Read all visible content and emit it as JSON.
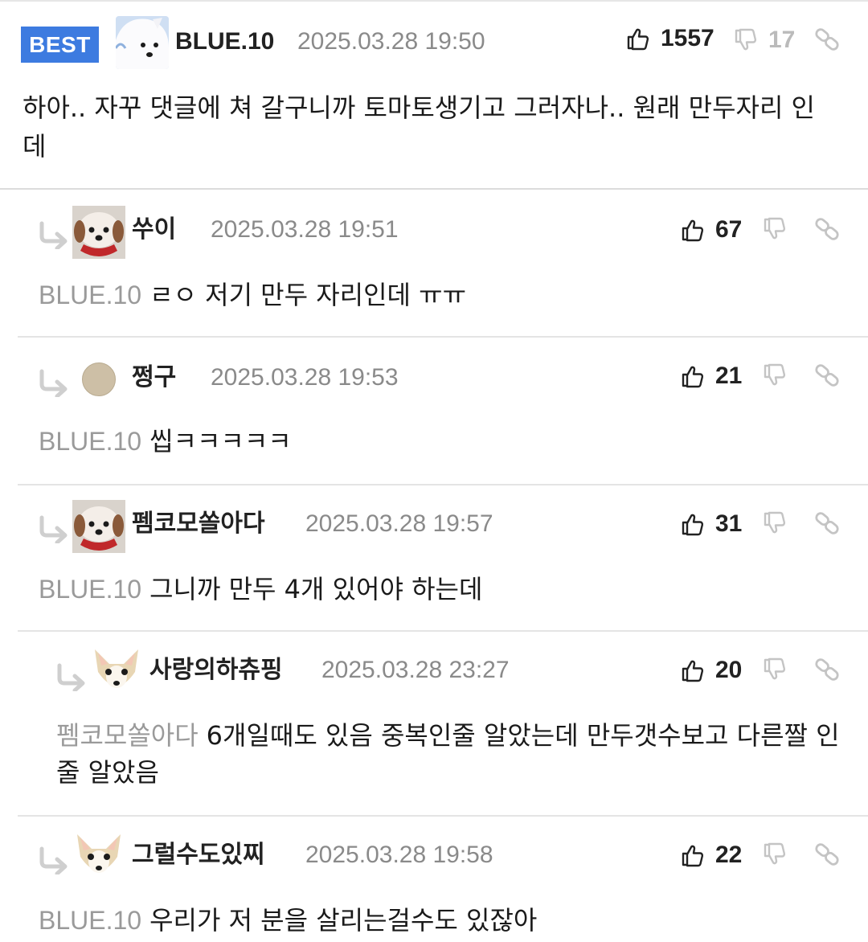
{
  "best": {
    "badge": "BEST",
    "author": "BLUE.10",
    "date": "2025.03.28 19:50",
    "likes": "1557",
    "dislikes": "17",
    "text": "하아.. 자꾸 댓글에 쳐 갈구니까 토마토생기고 그러자나.. 원래 만두자리 인데"
  },
  "replies": [
    {
      "author": "쑤이",
      "date": "2025.03.28 19:51",
      "likes": "67",
      "mention": "BLUE.10",
      "text": "ㄹㅇ 저기 만두 자리인데 ㅠㅠ",
      "avatar_icon": "puppy-avatar-icon"
    },
    {
      "author": "쩡구",
      "date": "2025.03.28 19:53",
      "likes": "21",
      "mention": "BLUE.10",
      "text": "씹ㅋㅋㅋㅋㅋ",
      "avatar_icon": "circle-avatar-icon"
    },
    {
      "author": "펨코모쏠아다",
      "date": "2025.03.28 19:57",
      "likes": "31",
      "mention": "BLUE.10",
      "text": "그니까 만두 4개 있어야 하는데",
      "avatar_icon": "puppy-avatar-icon"
    },
    {
      "author": "사랑의하츄핑",
      "date": "2025.03.28 23:27",
      "likes": "20",
      "mention": "펨코모쏠아다",
      "text": "6개일때도 있음 중복인줄 알았는데 만두갯수보고 다른짤 인줄 알았음",
      "avatar_icon": "chihuahua-avatar-icon"
    },
    {
      "author": "그럴수도있찌",
      "date": "2025.03.28 19:58",
      "likes": "22",
      "mention": "BLUE.10",
      "text": "우리가 저 분을 살리는걸수도 있잖아",
      "avatar_icon": "chihuahua-avatar-icon"
    }
  ],
  "colors": {
    "badge": "#3d7be0",
    "date": "#8a8a8a",
    "mention": "#9a9a9a",
    "icon_inactive": "#c4c4c4"
  }
}
